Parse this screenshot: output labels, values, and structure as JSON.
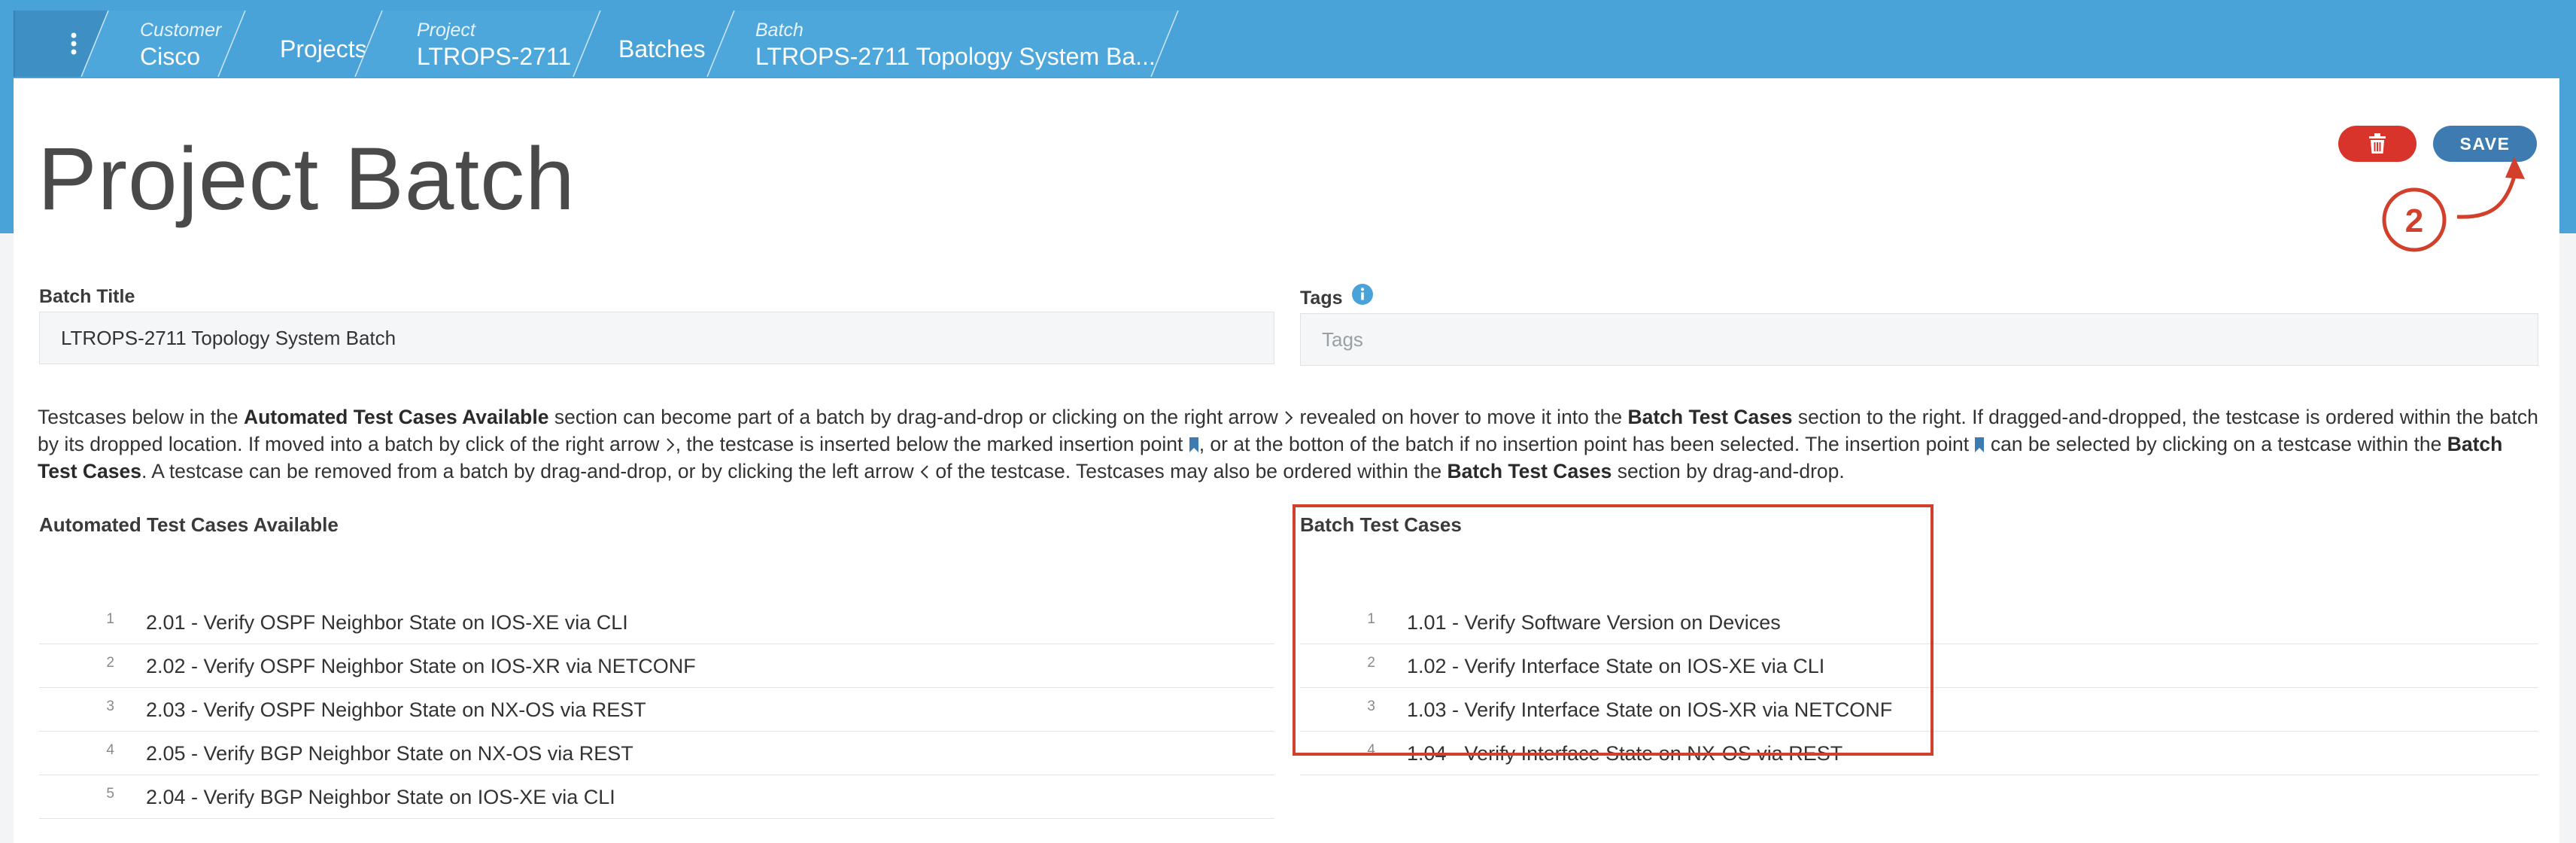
{
  "breadcrumbs": [
    {
      "label": "",
      "value": "",
      "kind": "menu"
    },
    {
      "label": "Customer",
      "value": "Cisco"
    },
    {
      "label": "",
      "value": "Projects"
    },
    {
      "label": "Project",
      "value": "LTROPS-2711"
    },
    {
      "label": "",
      "value": "Batches"
    },
    {
      "label": "Batch",
      "value": "LTROPS-2711 Topology System Ba..."
    }
  ],
  "page": {
    "title": "Project Batch"
  },
  "toolbar": {
    "save_label": "SAVE",
    "delete_icon": "trash-icon"
  },
  "annotation": {
    "marker": "2"
  },
  "form": {
    "batch_title_label": "Batch Title",
    "batch_title_value": "LTROPS-2711 Topology System Batch",
    "tags_label": "Tags",
    "tags_placeholder": "Tags"
  },
  "help": {
    "s1": "Testcases below in the ",
    "b1": "Automated Test Cases Available",
    "s2": " section can become part of a batch by drag-and-drop or clicking on the right arrow ",
    "s3": " revealed on hover to move it into the ",
    "b2": "Batch Test Cases",
    "s4": " section to the right. If dragged-and-dropped, the testcase is ordered within the batch by its dropped location. If moved into a batch by click of the right arrow ",
    "s5": ", the testcase is inserted below the marked insertion point ",
    "s6": ", or at the botton of the batch if no insertion point has been selected. The insertion point ",
    "s7": " can be selected by clicking on a testcase within the ",
    "b3": "Batch Test Cases",
    "s8": ". A testcase can be removed from a batch by drag-and-drop, or by clicking the left arrow ",
    "s9": " of the testcase. Testcases may also be ordered within the ",
    "b4": "Batch Test Cases",
    "s10": " section by drag-and-drop."
  },
  "available": {
    "title": "Automated Test Cases Available",
    "items": [
      {
        "num": "1",
        "name": "2.01 - Verify OSPF Neighbor State on IOS-XE via CLI"
      },
      {
        "num": "2",
        "name": "2.02 - Verify OSPF Neighbor State on IOS-XR via NETCONF"
      },
      {
        "num": "3",
        "name": "2.03 - Verify OSPF Neighbor State on NX-OS via REST"
      },
      {
        "num": "4",
        "name": "2.05 - Verify BGP Neighbor State on NX-OS via REST"
      },
      {
        "num": "5",
        "name": "2.04 - Verify BGP Neighbor State on IOS-XE via CLI"
      }
    ]
  },
  "batch": {
    "title": "Batch Test Cases",
    "items": [
      {
        "num": "1",
        "name": "1.01 - Verify Software Version on Devices"
      },
      {
        "num": "2",
        "name": "1.02 - Verify Interface State on IOS-XE via CLI"
      },
      {
        "num": "3",
        "name": "1.03 - Verify Interface State on IOS-XR via NETCONF"
      },
      {
        "num": "4",
        "name": "1.04 - Verify Interface State on NX-OS via REST"
      }
    ]
  },
  "colors": {
    "header": "#4aa3d8",
    "save": "#3d7bb1",
    "delete": "#d9342b",
    "highlight": "#d2402b"
  }
}
